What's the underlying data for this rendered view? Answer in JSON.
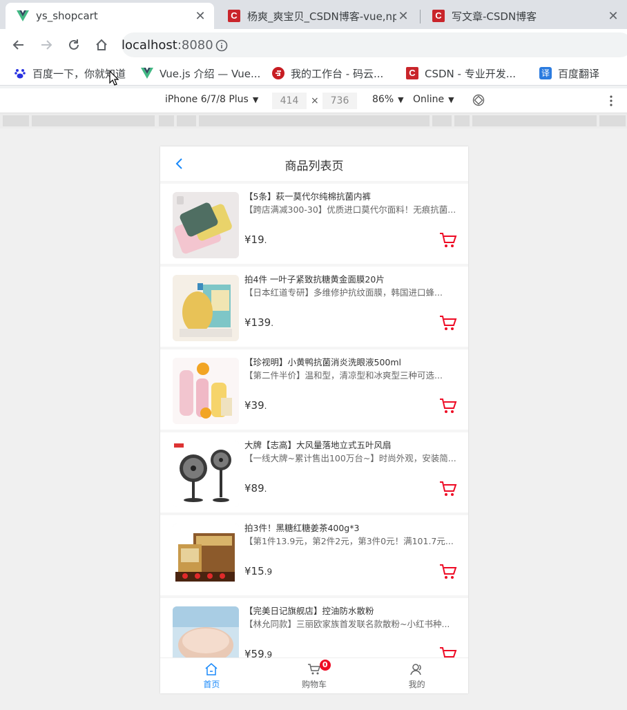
{
  "browser": {
    "tabs": [
      {
        "title": "ys_shopcart",
        "icon": "vue-logo-icon",
        "active": true
      },
      {
        "title": "杨爽_爽宝贝_CSDN博客-vue,npm",
        "icon": "csdn-icon",
        "active": false
      },
      {
        "title": "写文章-CSDN博客",
        "icon": "csdn-icon",
        "active": false
      }
    ],
    "close_glyph": "✕",
    "address": {
      "host": "localhost",
      "port": ":8080"
    },
    "bookmarks": [
      {
        "label": "百度一下，你就知道",
        "icon": "baidu-paw-icon"
      },
      {
        "label": "Vue.js 介绍 — Vue...",
        "icon": "vue-logo-icon"
      },
      {
        "label": "我的工作台 - 码云...",
        "icon": "gitee-icon"
      },
      {
        "label": "CSDN - 专业开发...",
        "icon": "csdn-icon"
      },
      {
        "label": "百度翻译",
        "icon": "translate-icon"
      }
    ],
    "csdn_letter": "C",
    "translate_glyph": "译"
  },
  "devtools": {
    "device": "iPhone 6/7/8 Plus",
    "width": "414",
    "times": "×",
    "height": "736",
    "zoom": "86%",
    "network": "Online",
    "caret": "▼"
  },
  "app": {
    "title": "商品列表页",
    "products": [
      {
        "name": "【5条】萩一莫代尔纯棉抗菌内裤",
        "desc": "【跨店满减300-30】优质进口莫代尔面料！无痕抗菌...",
        "price_int": "¥19",
        "price_dec": ".",
        "thumb": "underwear"
      },
      {
        "name": "拍4件 一叶子紧致抗糖黄金面膜20片",
        "desc": "【日本红道专研】多维修护抗纹面膜，韩国进口蜂...",
        "price_int": "¥139",
        "price_dec": ".",
        "thumb": "mask"
      },
      {
        "name": "【珍视明】小黄鸭抗菌消炎洗眼液500ml",
        "desc": "【第二件半价】温和型，清凉型和冰爽型三种可选...",
        "price_int": "¥39",
        "price_dec": ".",
        "thumb": "eyewash"
      },
      {
        "name": "大牌【志高】大风量落地立式五叶风扇",
        "desc": "【一线大牌~累计售出100万台~】时尚外观，安装简...",
        "price_int": "¥89",
        "price_dec": ".",
        "thumb": "fan"
      },
      {
        "name": "拍3件！黑糖红糖姜茶400g*3",
        "desc": "【第1件13.9元，第2件2元，第3件0元！满101.7元...",
        "price_int": "¥15",
        "price_dec": ".9",
        "thumb": "tea"
      },
      {
        "name": "【完美日记旗舰店】控油防水散粉",
        "desc": "【林允同款】三丽欧家族首发联名款散粉~小红书种...",
        "price_int": "¥59",
        "price_dec": ".9",
        "thumb": "powder"
      }
    ],
    "tabbar": [
      {
        "label": "首页",
        "icon": "home-icon",
        "active": true
      },
      {
        "label": "购物车",
        "icon": "cart-icon",
        "active": false,
        "badge": "0"
      },
      {
        "label": "我的",
        "icon": "user-icon",
        "active": false
      }
    ],
    "colors": {
      "accent": "#1989fa",
      "cart_red": "#ee0a24"
    }
  }
}
